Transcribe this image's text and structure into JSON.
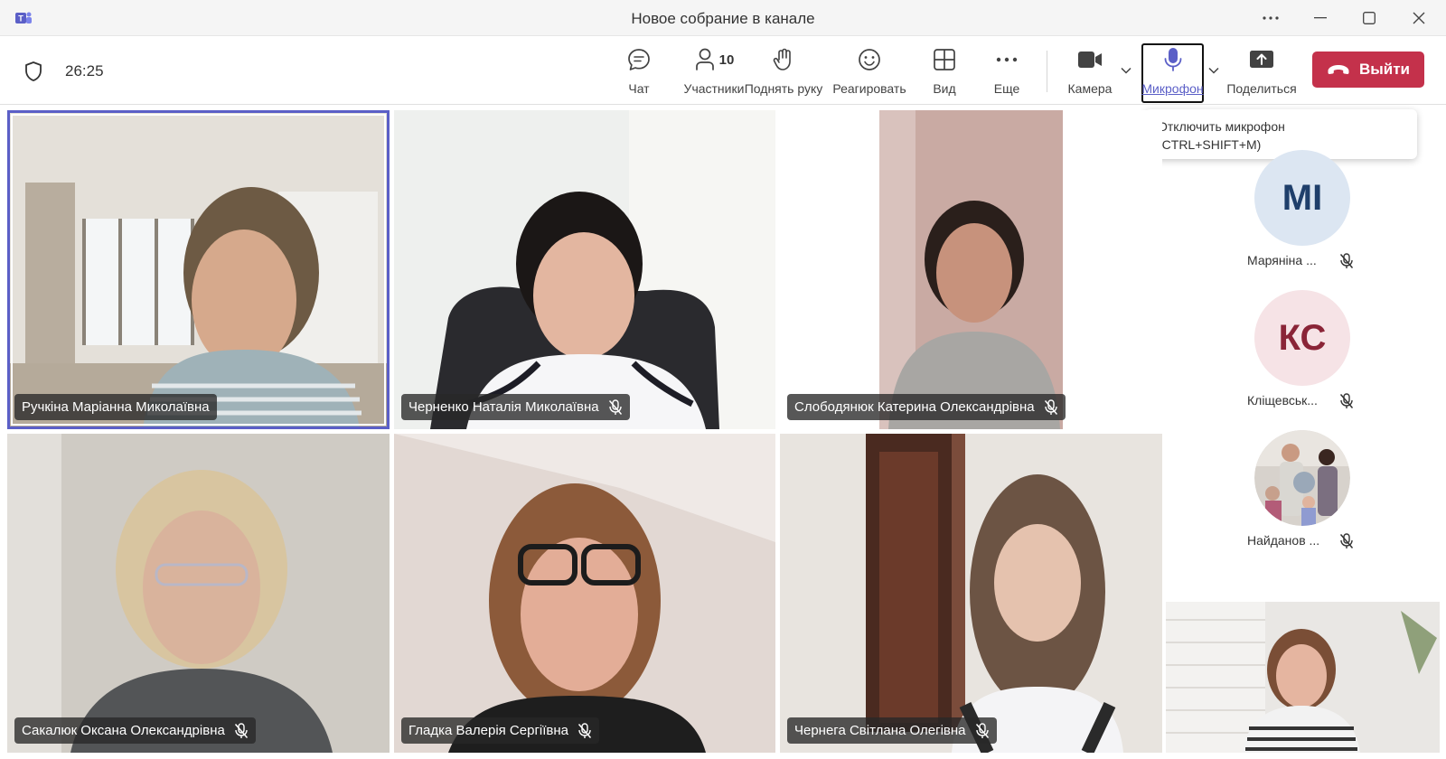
{
  "window": {
    "title": "Новое собрание в канале",
    "icons": {
      "app": "teams-logo-icon",
      "more": "more-dots-icon",
      "minimize": "minimize-icon",
      "maximize": "maximize-icon",
      "close": "close-icon"
    }
  },
  "toolbar": {
    "timer": "26:25",
    "participants_count": "10",
    "items": {
      "chat": "Чат",
      "participants": "Участники",
      "raise_hand": "Поднять руку",
      "react": "Реагировать",
      "view": "Вид",
      "more": "Еще",
      "camera": "Камера",
      "mic": "Микрофон",
      "share": "Поделиться"
    },
    "leave_label": "Выйти",
    "colors": {
      "accent": "#5b5fc7",
      "leave": "#c4314b"
    }
  },
  "tooltip": {
    "line1": "Отключить микрофон",
    "line2": "(CTRL+SHIFT+M)"
  },
  "tiles": [
    {
      "name": "Ручкіна Маріанна Миколаївна",
      "muted": false,
      "active": true
    },
    {
      "name": "Черненко Наталія Миколаївна",
      "muted": true
    },
    {
      "name": "Слободянюк Катерина Олександрівна",
      "muted": true
    },
    {
      "name": "Сакалюк Оксана Олександрівна",
      "muted": true
    },
    {
      "name": "Гладка Валерія Сергіївна",
      "muted": true
    },
    {
      "name": "Чернега Світлана Олегівна",
      "muted": true
    }
  ],
  "roster": [
    {
      "initials": "MI",
      "name": "Маряніна ...",
      "avatar_bg": "#dce6f2",
      "avatar_fg": "#1f3f6b",
      "muted": true
    },
    {
      "initials": "КС",
      "name": "Кліщевськ...",
      "avatar_bg": "#f6e3e6",
      "avatar_fg": "#8a2437",
      "muted": true
    },
    {
      "initials": "",
      "name": "Найданов ...",
      "photo": true,
      "muted": true
    }
  ]
}
